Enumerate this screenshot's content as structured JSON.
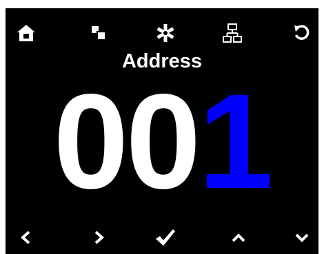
{
  "title": "Address",
  "address_digits": [
    "0",
    "0",
    "1"
  ],
  "active_digit_index": 2,
  "colors": {
    "screen_background": "#000000",
    "icon": "#ffffff",
    "digit": "#ffffff",
    "active_digit": "#0000ff"
  },
  "top_bar": {
    "icons": [
      "home-icon",
      "copy-icon",
      "asterisk-icon",
      "network-icon",
      "undo-icon"
    ]
  },
  "bottom_bar": {
    "icons": [
      "chevron-left-icon",
      "chevron-right-icon",
      "checkmark-icon",
      "chevron-up-icon",
      "chevron-down-icon"
    ]
  }
}
